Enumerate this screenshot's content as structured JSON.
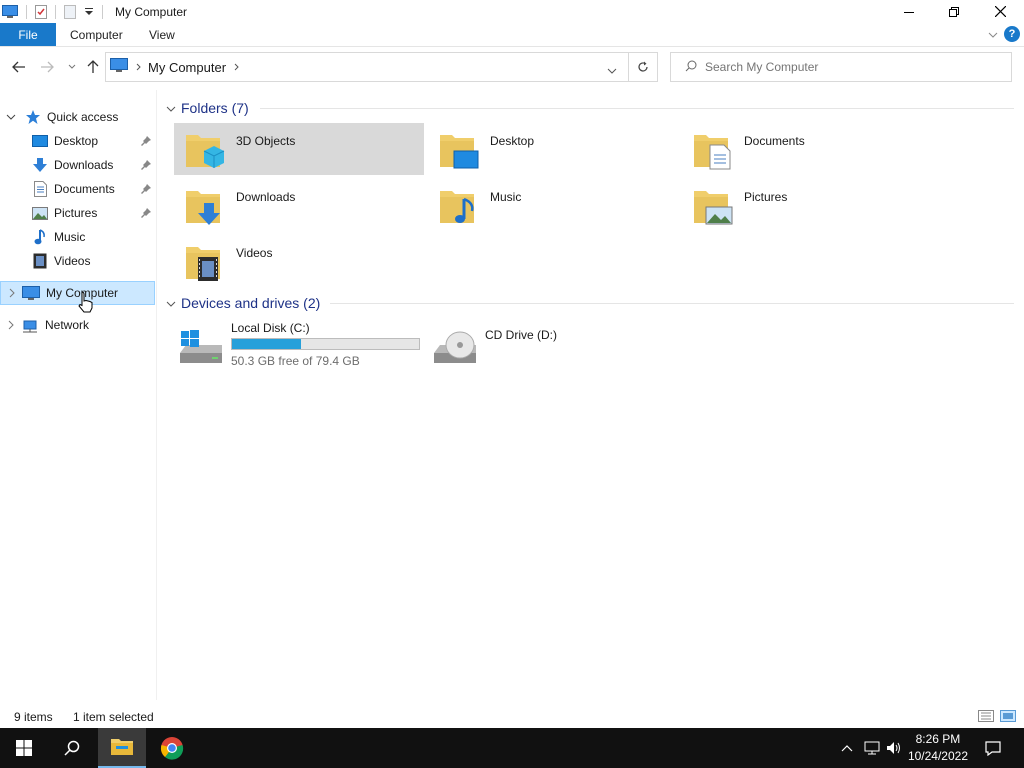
{
  "window": {
    "title": "My Computer"
  },
  "ribbon": {
    "tabs": [
      "File",
      "Computer",
      "View"
    ]
  },
  "address": {
    "path": "My Computer",
    "search_placeholder": "Search My Computer"
  },
  "nav": {
    "quick_access": "Quick access",
    "items": [
      "Desktop",
      "Downloads",
      "Documents",
      "Pictures",
      "Music",
      "Videos"
    ],
    "my_computer": "My Computer",
    "network": "Network"
  },
  "content": {
    "folders_header": "Folders (7)",
    "folders": [
      "3D Objects",
      "Desktop",
      "Documents",
      "Downloads",
      "Music",
      "Pictures",
      "Videos"
    ],
    "drives_header": "Devices and drives (2)",
    "drives": [
      {
        "name": "Local Disk (C:)",
        "free": "50.3 GB free of 79.4 GB",
        "used_fraction": 0.367
      },
      {
        "name": "CD Drive (D:)"
      }
    ]
  },
  "status": {
    "items": "9 items",
    "selected": "1 item selected"
  },
  "taskbar": {
    "time": "8:26 PM",
    "date": "10/24/2022"
  },
  "colors": {
    "accent": "#1979ca",
    "folder": "#e8c45e",
    "selected": "#cce8ff"
  }
}
